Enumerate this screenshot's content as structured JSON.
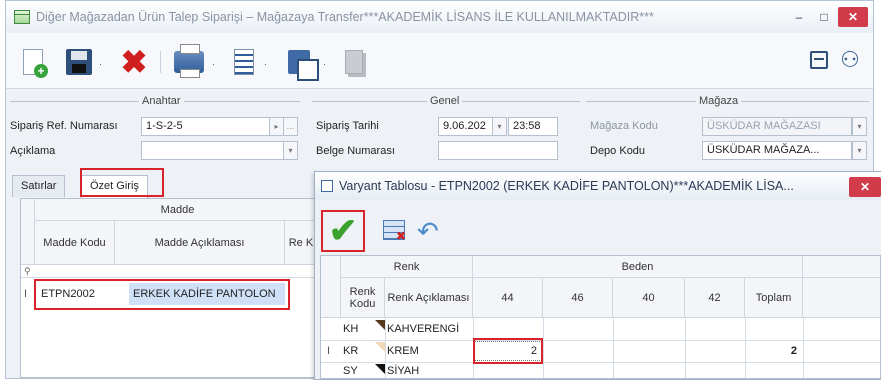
{
  "window": {
    "title": "Diğer Mağazadan Ürün Talep Siparişi – Mağazaya Transfer***AKADEMİK LİSANS İLE KULLANILMAKTADIR***",
    "minimize_glyph": "–",
    "maximize_glyph": "□",
    "close_glyph": "✕"
  },
  "toolbar": {
    "icons": [
      "new-document-icon",
      "save-icon",
      "delete-icon",
      "print-icon",
      "document-list-icon",
      "copy-icon",
      "disabled-document-icon",
      "window-icon",
      "binoculars-icon"
    ],
    "dropdown_glyph": "·"
  },
  "groups": {
    "anahtar": "Anahtar",
    "genel": "Genel",
    "magaza": "Mağaza"
  },
  "fields": {
    "siparis_ref_label": "Sipariş Ref. Numarası",
    "siparis_ref_value": "1-S-2-5",
    "aciklama_label": "Açıklama",
    "aciklama_value": "",
    "siparis_tarihi_label": "Sipariş Tarihi",
    "siparis_tarihi_value": "9.06.202",
    "siparis_saati_value": "23:58",
    "belge_no_label": "Belge Numarası",
    "belge_no_value": "",
    "magaza_kodu_label": "Mağaza Kodu",
    "magaza_kodu_value": "ÜSKÜDAR MAĞAZASI",
    "depo_kodu_label": "Depo Kodu",
    "depo_kodu_value": "ÜSKÜDAR MAĞAZA..."
  },
  "tabs": [
    "Satırlar",
    "Özet Giriş"
  ],
  "main_grid": {
    "group_header": "Madde",
    "columns": [
      "Madde Kodu",
      "Madde Açıklaması",
      "Re Kı"
    ],
    "row": {
      "indicator": "I",
      "kodu": "ETPN2002",
      "aciklama": "ERKEK KADİFE PANTOLON"
    }
  },
  "dialog": {
    "title": "Varyant Tablosu - ETPN2002 (ERKEK KADİFE PANTOLON)***AKADEMİK LİSA...",
    "close_glyph": "✕",
    "confirm_glyph": "✔",
    "undo_glyph": "↶",
    "group_renk": "Renk",
    "group_beden": "Beden",
    "col_renk_kodu": "Renk Kodu",
    "col_renk_aciklama": "Renk Açıklaması",
    "sizes": [
      "44",
      "46",
      "40",
      "42"
    ],
    "col_toplam": "Toplam",
    "rows": [
      {
        "indicator": "",
        "kod": "KH",
        "aciklama": "KAHVERENGİ",
        "q44": "",
        "toplam": "",
        "swatch": "#5a3a1e"
      },
      {
        "indicator": "I",
        "kod": "KR",
        "aciklama": "KREM",
        "q44": "2",
        "toplam": "2",
        "swatch": "#f1d9b8"
      },
      {
        "indicator": "",
        "kod": "SY",
        "aciklama": "SİYAH",
        "q44": "",
        "toplam": "",
        "swatch": "#111111"
      }
    ]
  },
  "colors": {
    "highlight_red": "#d8232a",
    "selection_blue": "#cfe0f7",
    "close_red": "#d13b4a"
  }
}
